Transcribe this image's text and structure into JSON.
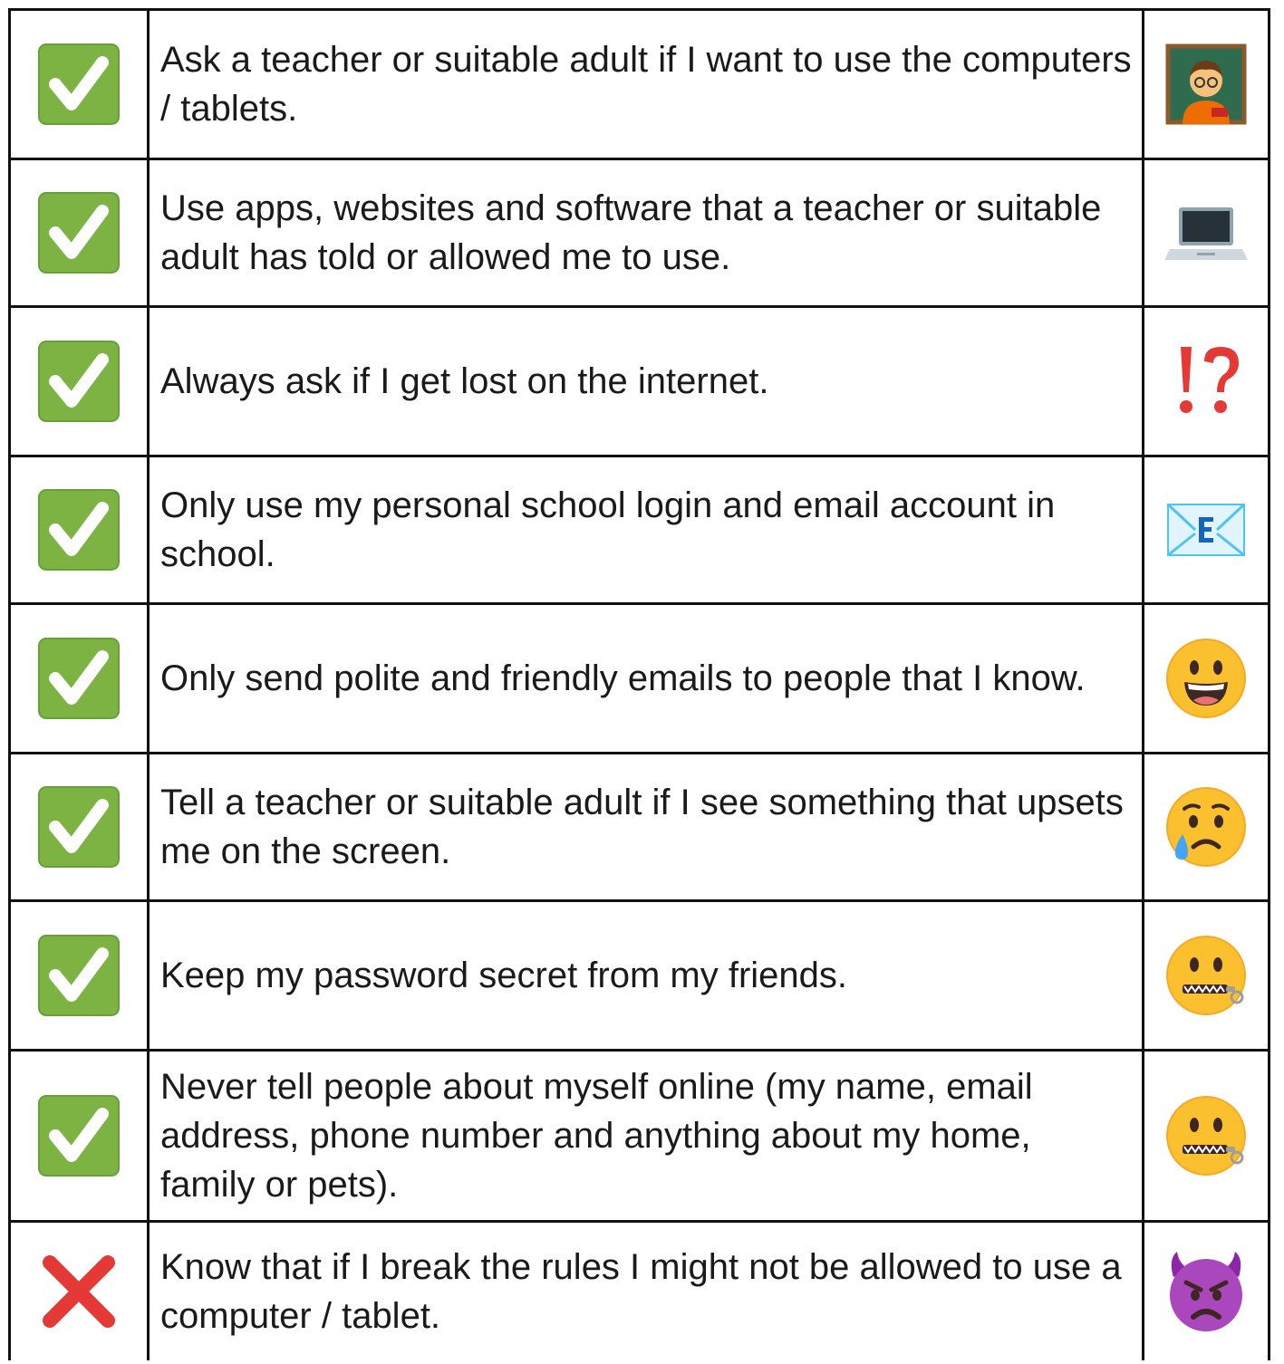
{
  "rows": [
    {
      "status": "check-icon",
      "text": "Ask a teacher or suitable adult if I want to use the computers / tablets.",
      "emoji": "teacher-icon"
    },
    {
      "status": "check-icon",
      "text": "Use apps, websites and software that a teacher or suitable adult has told or allowed me to use.",
      "emoji": "laptop-icon"
    },
    {
      "status": "check-icon",
      "text": "Always ask if I get lost on the internet.",
      "emoji": "interrobang-icon"
    },
    {
      "status": "check-icon",
      "text": "Only use my personal school login and email account in school.",
      "emoji": "email-icon"
    },
    {
      "status": "check-icon",
      "text": "Only send polite and friendly emails to people that I know.",
      "emoji": "grinning-face-icon"
    },
    {
      "status": "check-icon",
      "text": "Tell a teacher or suitable adult if I see something that upsets me on the screen.",
      "emoji": "crying-face-icon"
    },
    {
      "status": "check-icon",
      "text": "Keep my password secret from my friends.",
      "emoji": "zipper-mouth-icon"
    },
    {
      "status": "check-icon",
      "text": "Never tell people about myself online (my name, email address, phone number and anything about my home, family or pets).",
      "emoji": "zipper-mouth-icon"
    },
    {
      "status": "cross-icon",
      "text": "Know that if I break the rules I might not be allowed to use a computer / tablet.",
      "emoji": "angry-devil-icon"
    }
  ],
  "colors": {
    "check_green": "#7cb342",
    "cross_red": "#e53935",
    "border": "#111111"
  }
}
